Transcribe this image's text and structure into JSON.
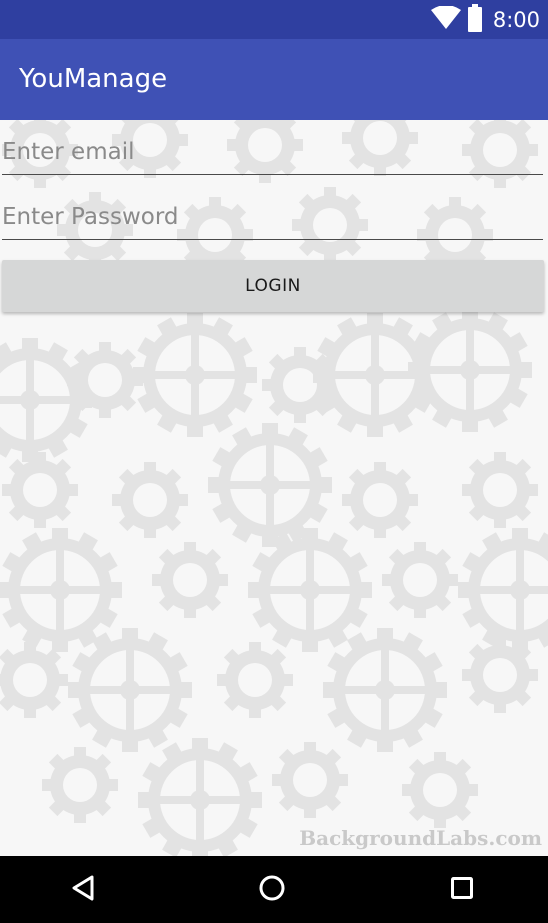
{
  "status_bar": {
    "time": "8:00",
    "icons": [
      "wifi-icon",
      "battery-icon"
    ]
  },
  "app_bar": {
    "title": "YouManage"
  },
  "form": {
    "email_placeholder": "Enter email",
    "email_value": "",
    "password_placeholder": "Enter Password",
    "password_value": "",
    "login_label": "LOGIN"
  },
  "background": {
    "watermark": "BackgroundLabs.com"
  },
  "nav_bar": {
    "buttons": [
      "back-icon",
      "home-icon",
      "recents-icon"
    ]
  },
  "colors": {
    "status_bar": "#2f3fa0",
    "app_bar": "#3f51b5",
    "button": "#d6d7d7",
    "nav_bar": "#000000"
  }
}
